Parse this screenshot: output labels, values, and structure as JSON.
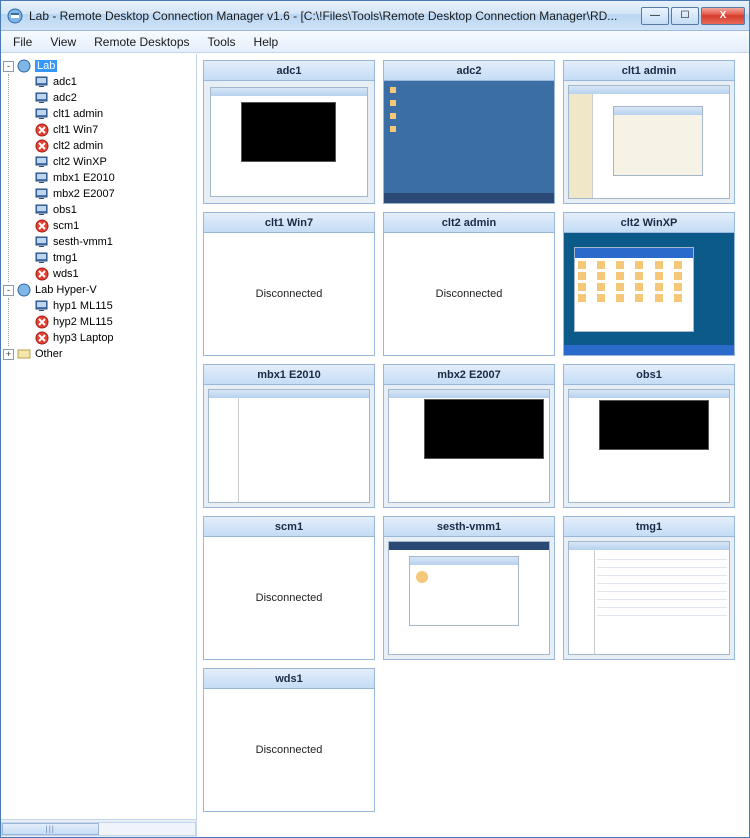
{
  "titlebar": {
    "text": "Lab - Remote Desktop Connection Manager v1.6 - [C:\\!Files\\Tools\\Remote Desktop Connection Manager\\RD..."
  },
  "wincontrols": {
    "min": "—",
    "max": "☐",
    "close": "X"
  },
  "menu": {
    "file": "File",
    "view": "View",
    "remote": "Remote Desktops",
    "tools": "Tools",
    "help": "Help"
  },
  "tree": {
    "lab": {
      "label": "Lab",
      "expander": "-"
    },
    "items": [
      {
        "label": "adc1",
        "status": "connected"
      },
      {
        "label": "adc2",
        "status": "connected"
      },
      {
        "label": "clt1 admin",
        "status": "connected"
      },
      {
        "label": "clt1 Win7",
        "status": "disconnected"
      },
      {
        "label": "clt2 admin",
        "status": "disconnected"
      },
      {
        "label": "clt2 WinXP",
        "status": "connected"
      },
      {
        "label": "mbx1 E2010",
        "status": "connected"
      },
      {
        "label": "mbx2 E2007",
        "status": "connected"
      },
      {
        "label": "obs1",
        "status": "connected"
      },
      {
        "label": "scm1",
        "status": "disconnected"
      },
      {
        "label": "sesth-vmm1",
        "status": "connected"
      },
      {
        "label": "tmg1",
        "status": "connected"
      },
      {
        "label": "wds1",
        "status": "disconnected"
      }
    ],
    "hyperv": {
      "label": "Lab Hyper-V",
      "expander": "-"
    },
    "hypervItems": [
      {
        "label": "hyp1 ML115",
        "status": "connected"
      },
      {
        "label": "hyp2 ML115",
        "status": "disconnected"
      },
      {
        "label": "hyp3 Laptop",
        "status": "disconnected"
      }
    ],
    "other": {
      "label": "Other",
      "expander": "+"
    }
  },
  "statusText": {
    "disconnected": "Disconnected"
  },
  "thumbs": [
    {
      "label": "adc1",
      "kind": "connected-console"
    },
    {
      "label": "adc2",
      "kind": "connected-bluedesktop"
    },
    {
      "label": "clt1 admin",
      "kind": "connected-light"
    },
    {
      "label": "clt1 Win7",
      "kind": "disconnected"
    },
    {
      "label": "clt2 admin",
      "kind": "disconnected"
    },
    {
      "label": "clt2 WinXP",
      "kind": "connected-xp"
    },
    {
      "label": "mbx1 E2010",
      "kind": "connected-app1"
    },
    {
      "label": "mbx2 E2007",
      "kind": "connected-console2"
    },
    {
      "label": "obs1",
      "kind": "connected-console3"
    },
    {
      "label": "scm1",
      "kind": "disconnected"
    },
    {
      "label": "sesth-vmm1",
      "kind": "connected-wizard"
    },
    {
      "label": "tmg1",
      "kind": "connected-grid"
    },
    {
      "label": "wds1",
      "kind": "disconnected"
    }
  ],
  "scroll": {
    "grip": "|||"
  }
}
